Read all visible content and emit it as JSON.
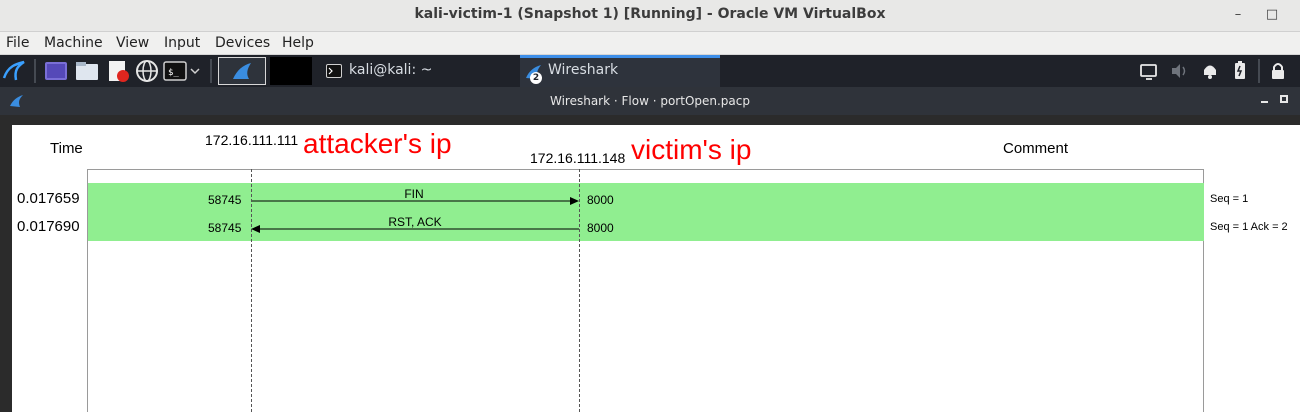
{
  "host_window": {
    "title": "kali-victim-1 (Snapshot 1) [Running] - Oracle VM VirtualBox",
    "minimize_glyph": "–",
    "maximize_glyph": "□"
  },
  "host_menu": [
    "File",
    "Machine",
    "View",
    "Input",
    "Devices",
    "Help"
  ],
  "kali_panel": {
    "terminal_task": "kali@kali: ~",
    "wireshark_task": "Wireshark",
    "wireshark_badge": "2",
    "icons": [
      "kali-menu-icon",
      "workspace-icon",
      "file-manager-icon",
      "text-editor-icon",
      "browser-icon",
      "terminal-icon",
      "chevron-down-icon",
      "wireshark-icon",
      "display-icon",
      "volume-icon",
      "bell-icon",
      "battery-icon",
      "lock-icon"
    ]
  },
  "flow_window": {
    "title": "Wireshark · Flow · portOpen.pacp",
    "headers": {
      "time": "Time",
      "host_a": "172.16.111.111",
      "host_b": "172.16.111.148",
      "comment": "Comment"
    },
    "annotations": {
      "attacker": "attacker's ip",
      "victim": "victim's ip"
    },
    "rows": [
      {
        "time": "0.017659",
        "src_port": "58745",
        "dst_port": "8000",
        "label": "FIN",
        "direction": "right",
        "comment": "Seq = 1"
      },
      {
        "time": "0.017690",
        "src_port": "58745",
        "dst_port": "8000",
        "label": "RST, ACK",
        "direction": "left",
        "comment": "Seq = 1 Ack = 2"
      }
    ],
    "colors": {
      "row_highlight": "#90ee90",
      "annotation_red": "#ff0000"
    }
  }
}
